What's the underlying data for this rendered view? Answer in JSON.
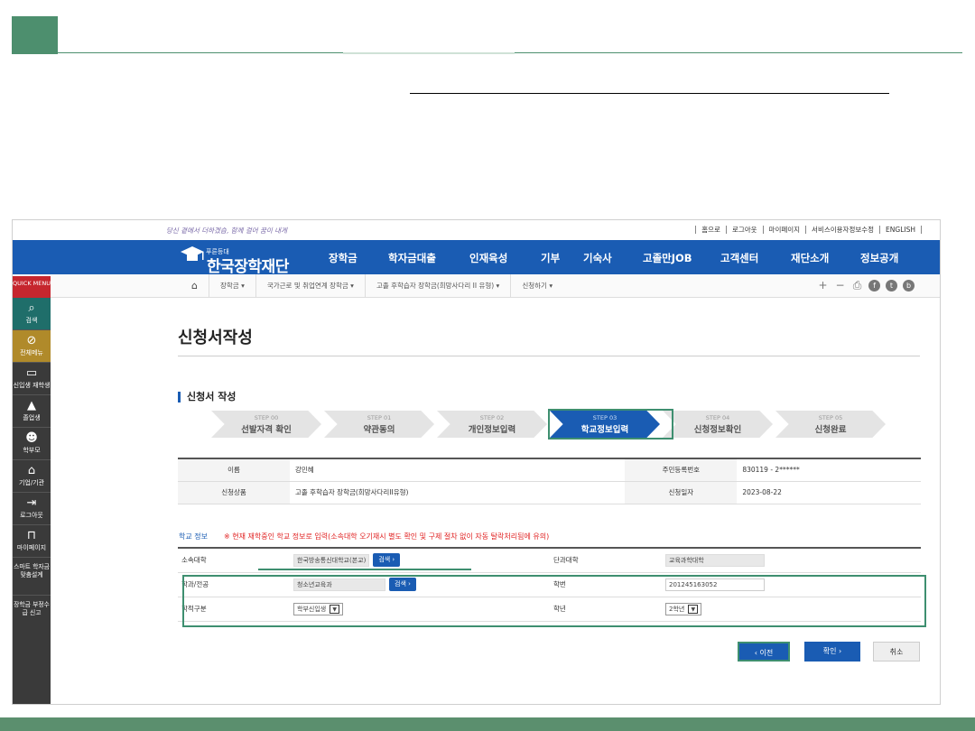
{
  "util": {
    "slogan": "당신 곁에서 더하겠습, 함께 걸어 꿈이 내게",
    "links": [
      "홈으로",
      "로그아웃",
      "마이페이지",
      "서비스이용자정보수정",
      "ENGLISH"
    ]
  },
  "logo": {
    "sub": "푸른등대",
    "main": "한국장학재단"
  },
  "gnb": [
    "장학금",
    "학자금대출",
    "인재육성",
    "기부",
    "기숙사",
    "고졸만JOB",
    "고객센터",
    "재단소개",
    "정보공개"
  ],
  "breadcrumb": [
    "장학금",
    "국가근로 및 취업연계 장학금",
    "고졸 후학습자 장학금(희망사다리 II 유형)",
    "신청하기"
  ],
  "quick": {
    "head": "QUICK MENU",
    "items": [
      "검색",
      "전체메뉴",
      "신입생 재학생",
      "졸업생",
      "학부모",
      "기업/기관",
      "로그아웃",
      "마이페이지",
      "스마트 학자금 맞춤설계",
      "장학금 부정수급 신고"
    ]
  },
  "page_title": "신청서작성",
  "section_title": "신청서 작성",
  "steps": [
    {
      "num": "STEP 00",
      "label": "선발자격 확인"
    },
    {
      "num": "STEP 01",
      "label": "약관동의"
    },
    {
      "num": "STEP 02",
      "label": "개인정보입력"
    },
    {
      "num": "STEP 03",
      "label": "학교정보입력"
    },
    {
      "num": "STEP 04",
      "label": "신청정보확인"
    },
    {
      "num": "STEP 05",
      "label": "신청완료"
    }
  ],
  "info": {
    "name_label": "이름",
    "name_value": "강민혜",
    "rrn_label": "주민등록번호",
    "rrn_value": "830119 - 2******",
    "product_label": "신청상품",
    "product_value": "고졸 후학습자 장학금(희망사다리II유형)",
    "date_label": "신청일자",
    "date_value": "2023-08-22"
  },
  "school": {
    "label": "학교 정보",
    "note": "※ 현재 재학중인 학교 정보로 입력(소속대학 오기재시 별도 확인 및 구제 절차 없이 자동 탈락처리됨에 유의)",
    "univ_label": "소속대학",
    "univ_value": "한국방송통신대학교(본교)",
    "college_label": "단과대학",
    "college_value": "교육과학대학",
    "dept_label": "학과/전공",
    "dept_value": "청소년교육과",
    "id_label": "학번",
    "id_value": "201245163052",
    "type_label": "학적구분",
    "type_value": "학부신입생",
    "year_label": "학년",
    "year_value": "2학년",
    "search_label": "검색"
  },
  "buttons": {
    "prev": "이전",
    "ok": "확인",
    "cancel": "취소"
  }
}
